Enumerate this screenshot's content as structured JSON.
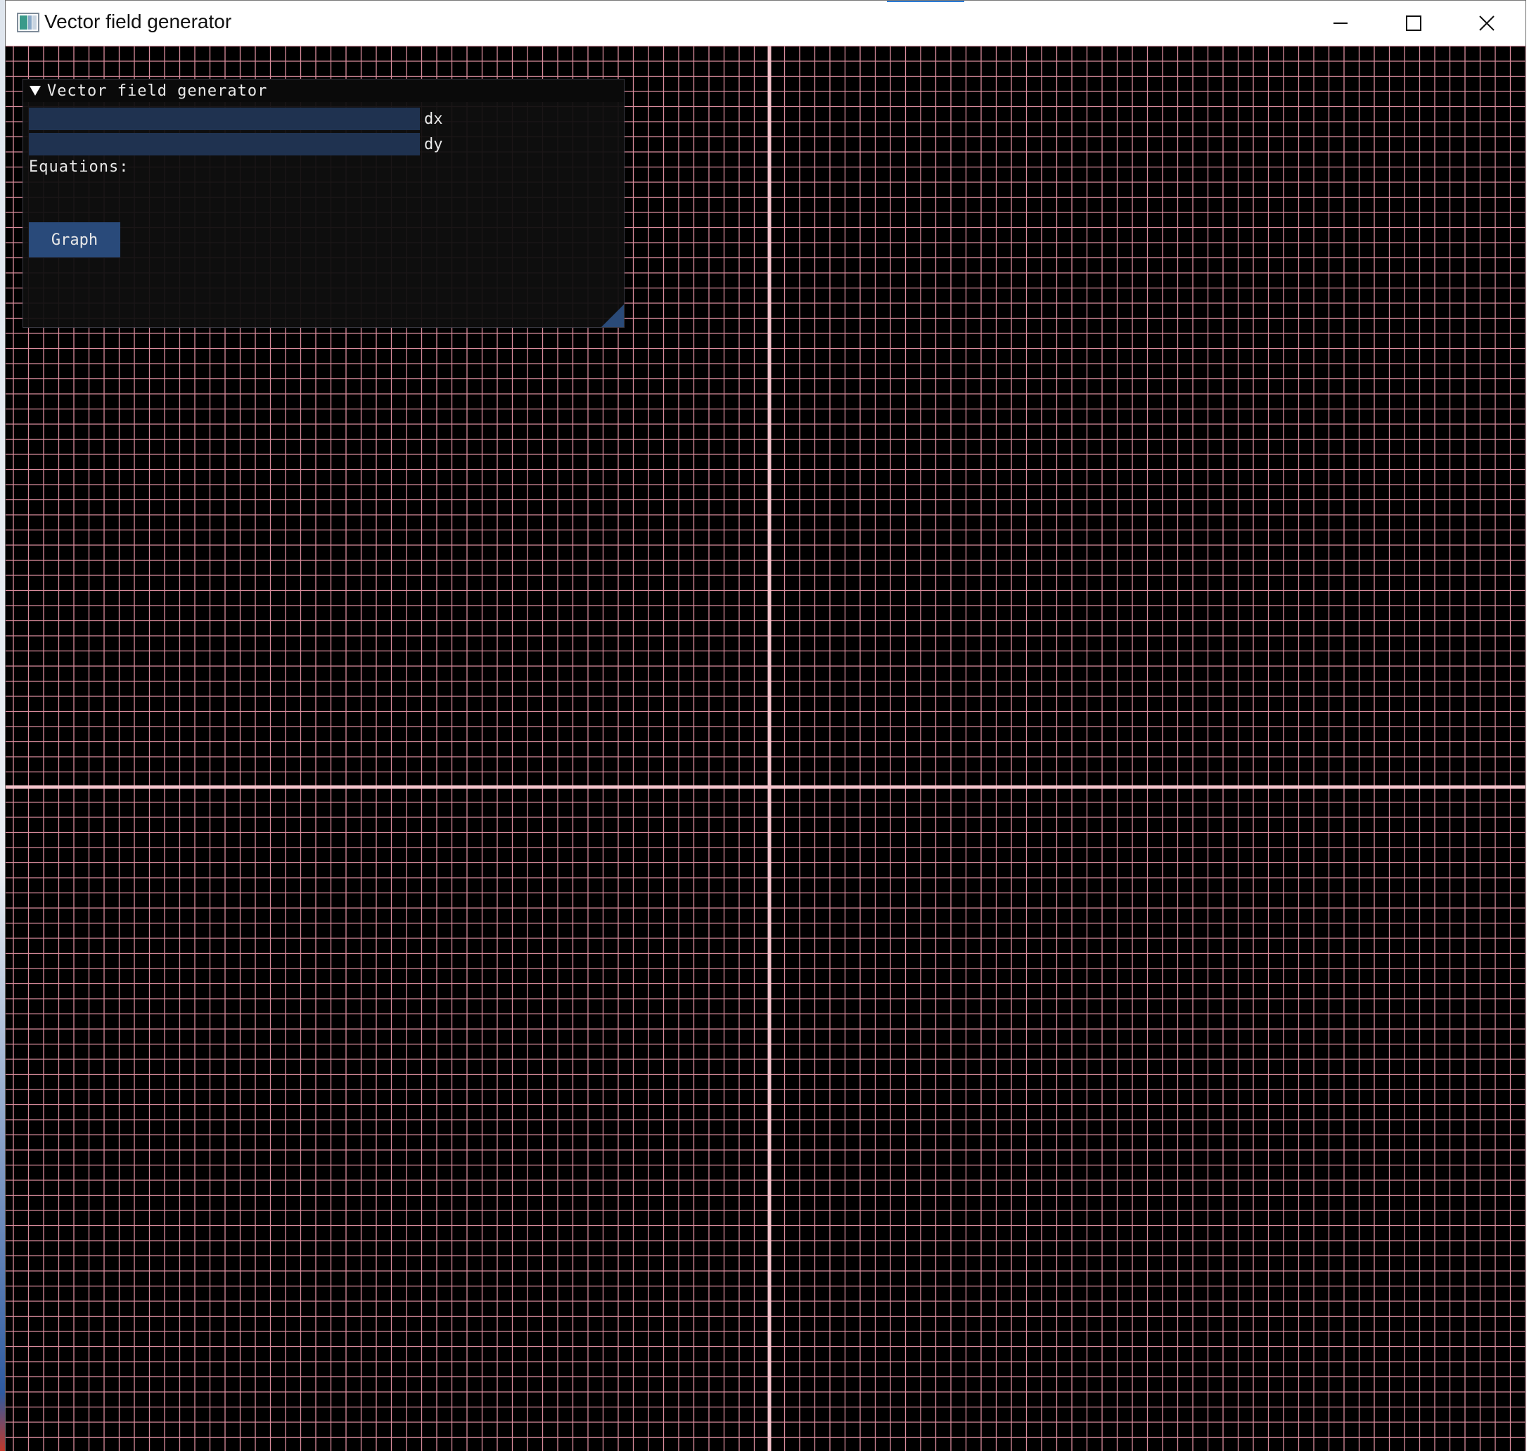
{
  "window": {
    "title": "Vector field generator",
    "icons": {
      "app": "app-window-icon",
      "minimize": "minimize-icon",
      "maximize": "maximize-icon",
      "close": "close-icon"
    }
  },
  "panel": {
    "title": "Vector field generator",
    "collapse_icon": "triangle-down-icon",
    "dx": {
      "label": "dx",
      "value": ""
    },
    "dy": {
      "label": "dy",
      "value": ""
    },
    "equations_label": "Equations:",
    "graph_button": "Graph"
  },
  "colors": {
    "background": "#000000",
    "grid_line": "#d98c9c",
    "axis_line": "#f4c4cc",
    "input_bg": "#1f3250",
    "button_bg": "#294a7a",
    "panel_bg": "#0f0f0f"
  }
}
